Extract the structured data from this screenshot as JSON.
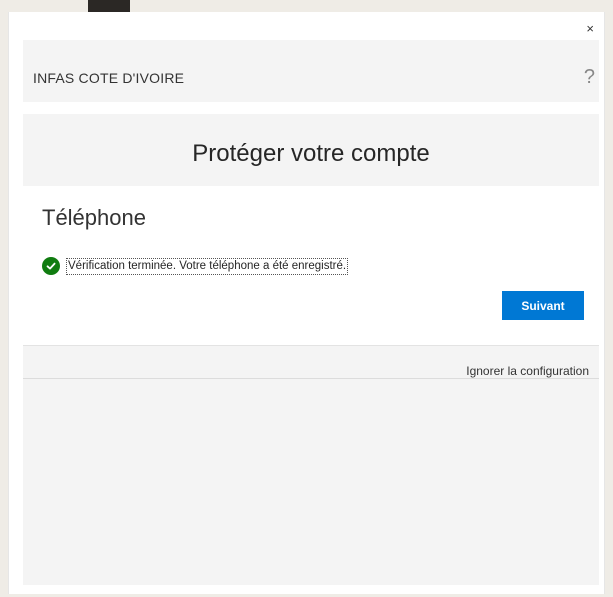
{
  "header": {
    "org_name": "INFAS COTE D'IVOIRE",
    "help_symbol": "?",
    "close_symbol": "×"
  },
  "main": {
    "title": "Protéger votre compte",
    "section_title": "Téléphone",
    "status_message": "Vérification terminée. Votre téléphone a été enregistré.",
    "next_button_label": "Suivant"
  },
  "footer": {
    "skip_label": "Ignorer la configuration"
  },
  "icons": {
    "status": "check-circle-icon",
    "help": "question-mark-icon",
    "close": "close-icon"
  },
  "colors": {
    "accent": "#0078d4",
    "success": "#107c10"
  }
}
